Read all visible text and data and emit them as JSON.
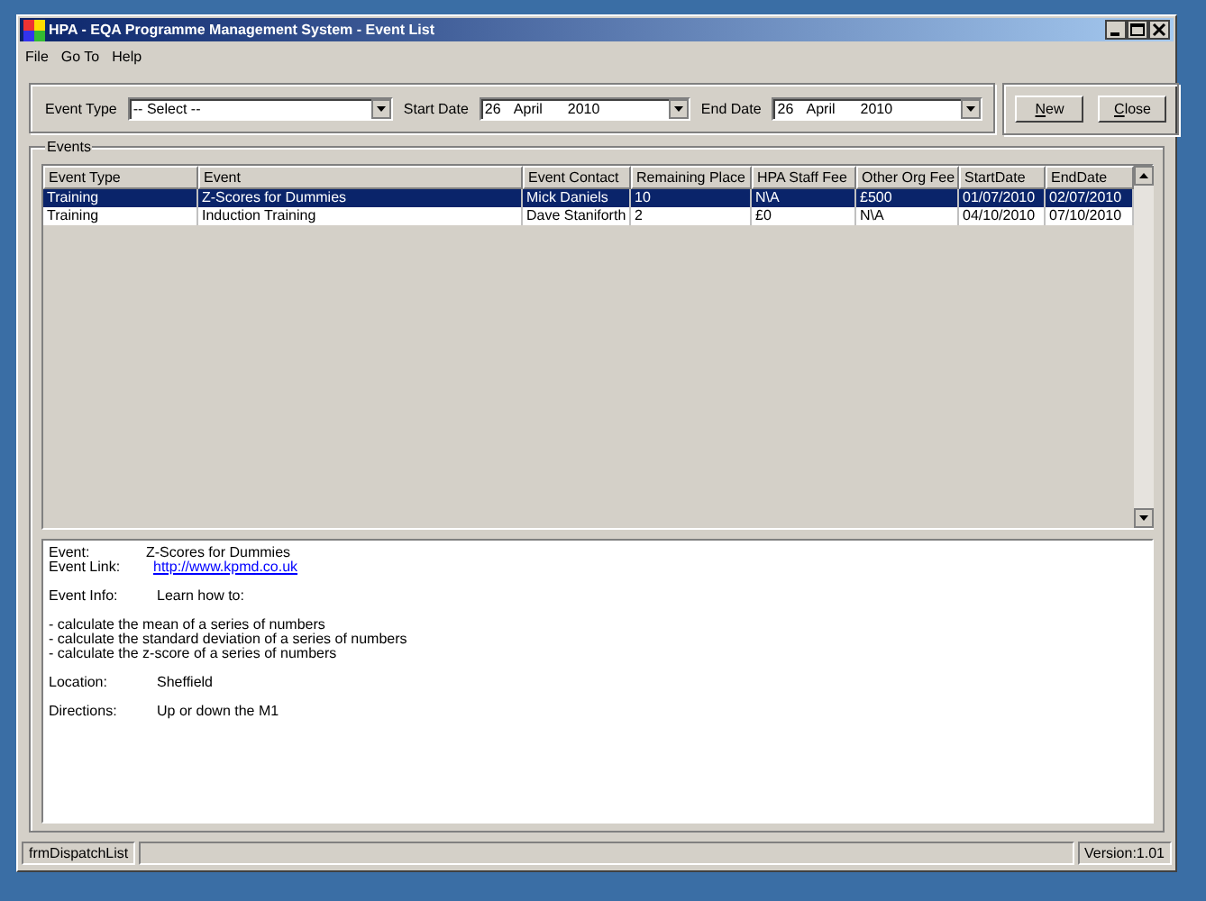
{
  "window": {
    "title": "HPA - EQA Programme Management System - Event List"
  },
  "menu": [
    {
      "label": "File"
    },
    {
      "label": "Go To"
    },
    {
      "label": "Help"
    }
  ],
  "filters": [
    {
      "label": "Event Type",
      "value": "-- Select --",
      "kind": "select"
    },
    {
      "label": "Start Date",
      "kind": "date",
      "day": "26",
      "month": "April",
      "year": "2010"
    },
    {
      "label": "End Date",
      "kind": "date",
      "day": "26",
      "month": "April",
      "year": "2010"
    }
  ],
  "buttons": [
    {
      "label": "New"
    },
    {
      "label": "Close"
    }
  ],
  "events_group": {
    "title": "Events"
  },
  "table": {
    "columns": [
      "Event Type",
      "Event",
      "Event Contact",
      "Remaining Place",
      "HPA Staff Fee",
      "Other Org Fee",
      "StartDate",
      "EndDate"
    ],
    "rows": [
      {
        "selected": true,
        "cells": [
          "Training",
          "Z-Scores for Dummies",
          "Mick Daniels",
          "10",
          "N\\A",
          "£500",
          "01/07/2010",
          "02/07/2010"
        ]
      },
      {
        "selected": false,
        "cells": [
          "Training",
          "Induction Training",
          "Dave Staniforth",
          "2",
          "£0",
          "N\\A",
          "04/10/2010",
          "07/10/2010"
        ]
      }
    ]
  },
  "details": [
    [
      {
        "kind": "field",
        "label": "Event:",
        "value": "Z-Scores for Dummies"
      },
      {
        "kind": "link",
        "label": "Event Link:",
        "value": "http://www.kpmd.co.uk"
      }
    ],
    [
      {
        "kind": "field",
        "label": "Event Info:",
        "value": "Learn how to:"
      }
    ],
    [
      {
        "kind": "bullet",
        "value": "- calculate the mean of a series of numbers"
      },
      {
        "kind": "bullet",
        "value": "- calculate the standard deviation of a series of numbers"
      },
      {
        "kind": "bullet",
        "value": "- calculate the z-score of a series of numbers"
      }
    ],
    [
      {
        "kind": "field",
        "label": "Location:",
        "value": "Sheffield"
      }
    ],
    [
      {
        "kind": "field",
        "label": "Directions:",
        "value": "Up or down the M1"
      }
    ]
  ],
  "status_bar": {
    "form": "frmDispatchList",
    "version": "Version:1.01"
  }
}
